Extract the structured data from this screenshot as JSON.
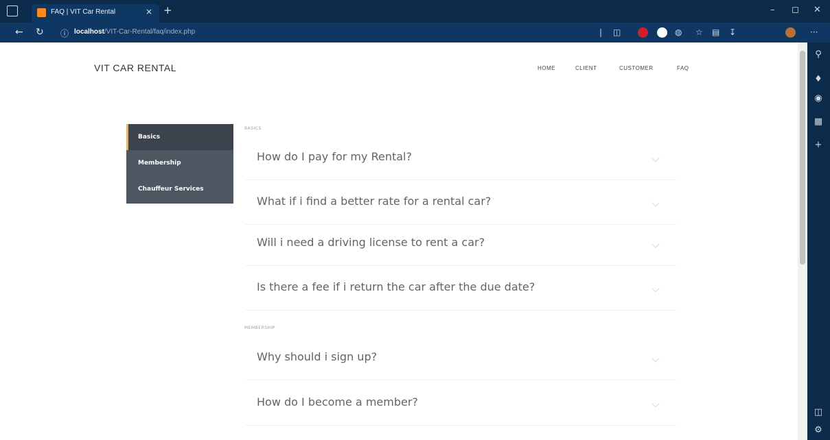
{
  "browser": {
    "tab_title": "FAQ | VIT Car Rental",
    "tab_close": "×",
    "new_tab": "+",
    "url_host": "localhost",
    "url_path": "/VIT-Car-Rental/faq/index.php",
    "window_controls": [
      "–",
      "◻",
      "✕"
    ],
    "sidebar_icons": [
      "search-icon",
      "tag-icon",
      "office-icon",
      "outlook-icon",
      "add-icon",
      "layout-icon",
      "settings-icon"
    ],
    "sidebar_add": "+",
    "more_menu": "···"
  },
  "site": {
    "brand": "VIT CAR RENTAL",
    "nav": [
      "HOME",
      "CLIENT",
      "CUSTOMER",
      "FAQ"
    ]
  },
  "sidenav": {
    "items": [
      "Basics",
      "Membership",
      "Chauffeur Services"
    ],
    "active": "Basics"
  },
  "sections": [
    {
      "label": "BASICS",
      "questions": [
        "How do I pay for my Rental?",
        "What if i find a better rate for a rental car?",
        "Will i need a driving license to rent a car?",
        "Is there a fee if i return the car after the due date?"
      ]
    },
    {
      "label": "MEMBERSHIP",
      "questions": [
        "Why should i sign up?",
        "How do I become a member?"
      ]
    }
  ],
  "colors": {
    "browser_dark": "#0c2b4b",
    "browser_mid": "#0f3763",
    "sidenav_bg": "#4e5661",
    "sidenav_active": "#3c434d",
    "accent": "#d9b87c"
  }
}
